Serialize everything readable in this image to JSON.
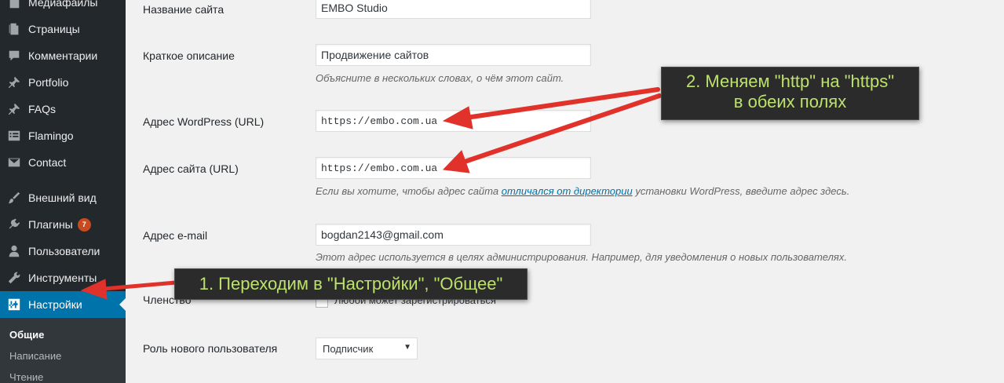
{
  "sidebar": {
    "items": [
      {
        "label": "Медиафайлы",
        "icon": "media-icon"
      },
      {
        "label": "Страницы",
        "icon": "pages-icon"
      },
      {
        "label": "Комментарии",
        "icon": "comments-icon"
      },
      {
        "label": "Portfolio",
        "icon": "pin-icon"
      },
      {
        "label": "FAQs",
        "icon": "pin-icon"
      },
      {
        "label": "Flamingo",
        "icon": "list-icon"
      },
      {
        "label": "Contact",
        "icon": "mail-icon"
      },
      {
        "label": "Внешний вид",
        "icon": "brush-icon"
      },
      {
        "label": "Плагины",
        "icon": "plugin-icon",
        "badge": "7"
      },
      {
        "label": "Пользователи",
        "icon": "users-icon"
      },
      {
        "label": "Инструменты",
        "icon": "wrench-icon"
      },
      {
        "label": "Настройки",
        "icon": "settings-icon",
        "active": true
      }
    ],
    "submenu": [
      "Общие",
      "Написание",
      "Чтение"
    ]
  },
  "form": {
    "site_title": {
      "label": "Название сайта",
      "value": "EMBO Studio"
    },
    "tagline": {
      "label": "Краткое описание",
      "value": "Продвижение сайтов",
      "description": "Объясните в нескольких словах, о чём этот сайт."
    },
    "wp_url": {
      "label": "Адрес WordPress (URL)",
      "value": "https://embo.com.ua"
    },
    "site_url": {
      "label": "Адрес сайта (URL)",
      "value": "https://embo.com.ua",
      "desc_before": "Если вы хотите, чтобы адрес сайта",
      "desc_link": "отличался от директории",
      "desc_after": "установки WordPress, введите адрес здесь."
    },
    "email": {
      "label": "Адрес e-mail",
      "value": "bogdan2143@gmail.com",
      "description": "Этот адрес используется в целях администрирования. Например, для уведомления о новых пользователях."
    },
    "membership": {
      "label": "Членство",
      "checkbox_label": "Любой может зарегистрироваться"
    },
    "default_role": {
      "label": "Роль нового пользователя",
      "selected": "Подписчик"
    }
  },
  "annotations": {
    "callout_1": "1. Переходим в \"Настройки\", \"Общее\"",
    "callout_2_line1": "2. Меняем \"http\" на \"https\"",
    "callout_2_line2": "в обеих полях"
  },
  "colors": {
    "sidebar_bg": "#23282d",
    "active_bg": "#0073aa",
    "arrow": "#e0322a",
    "callout_text": "#bde26c",
    "badge": "#ca4a1f"
  }
}
